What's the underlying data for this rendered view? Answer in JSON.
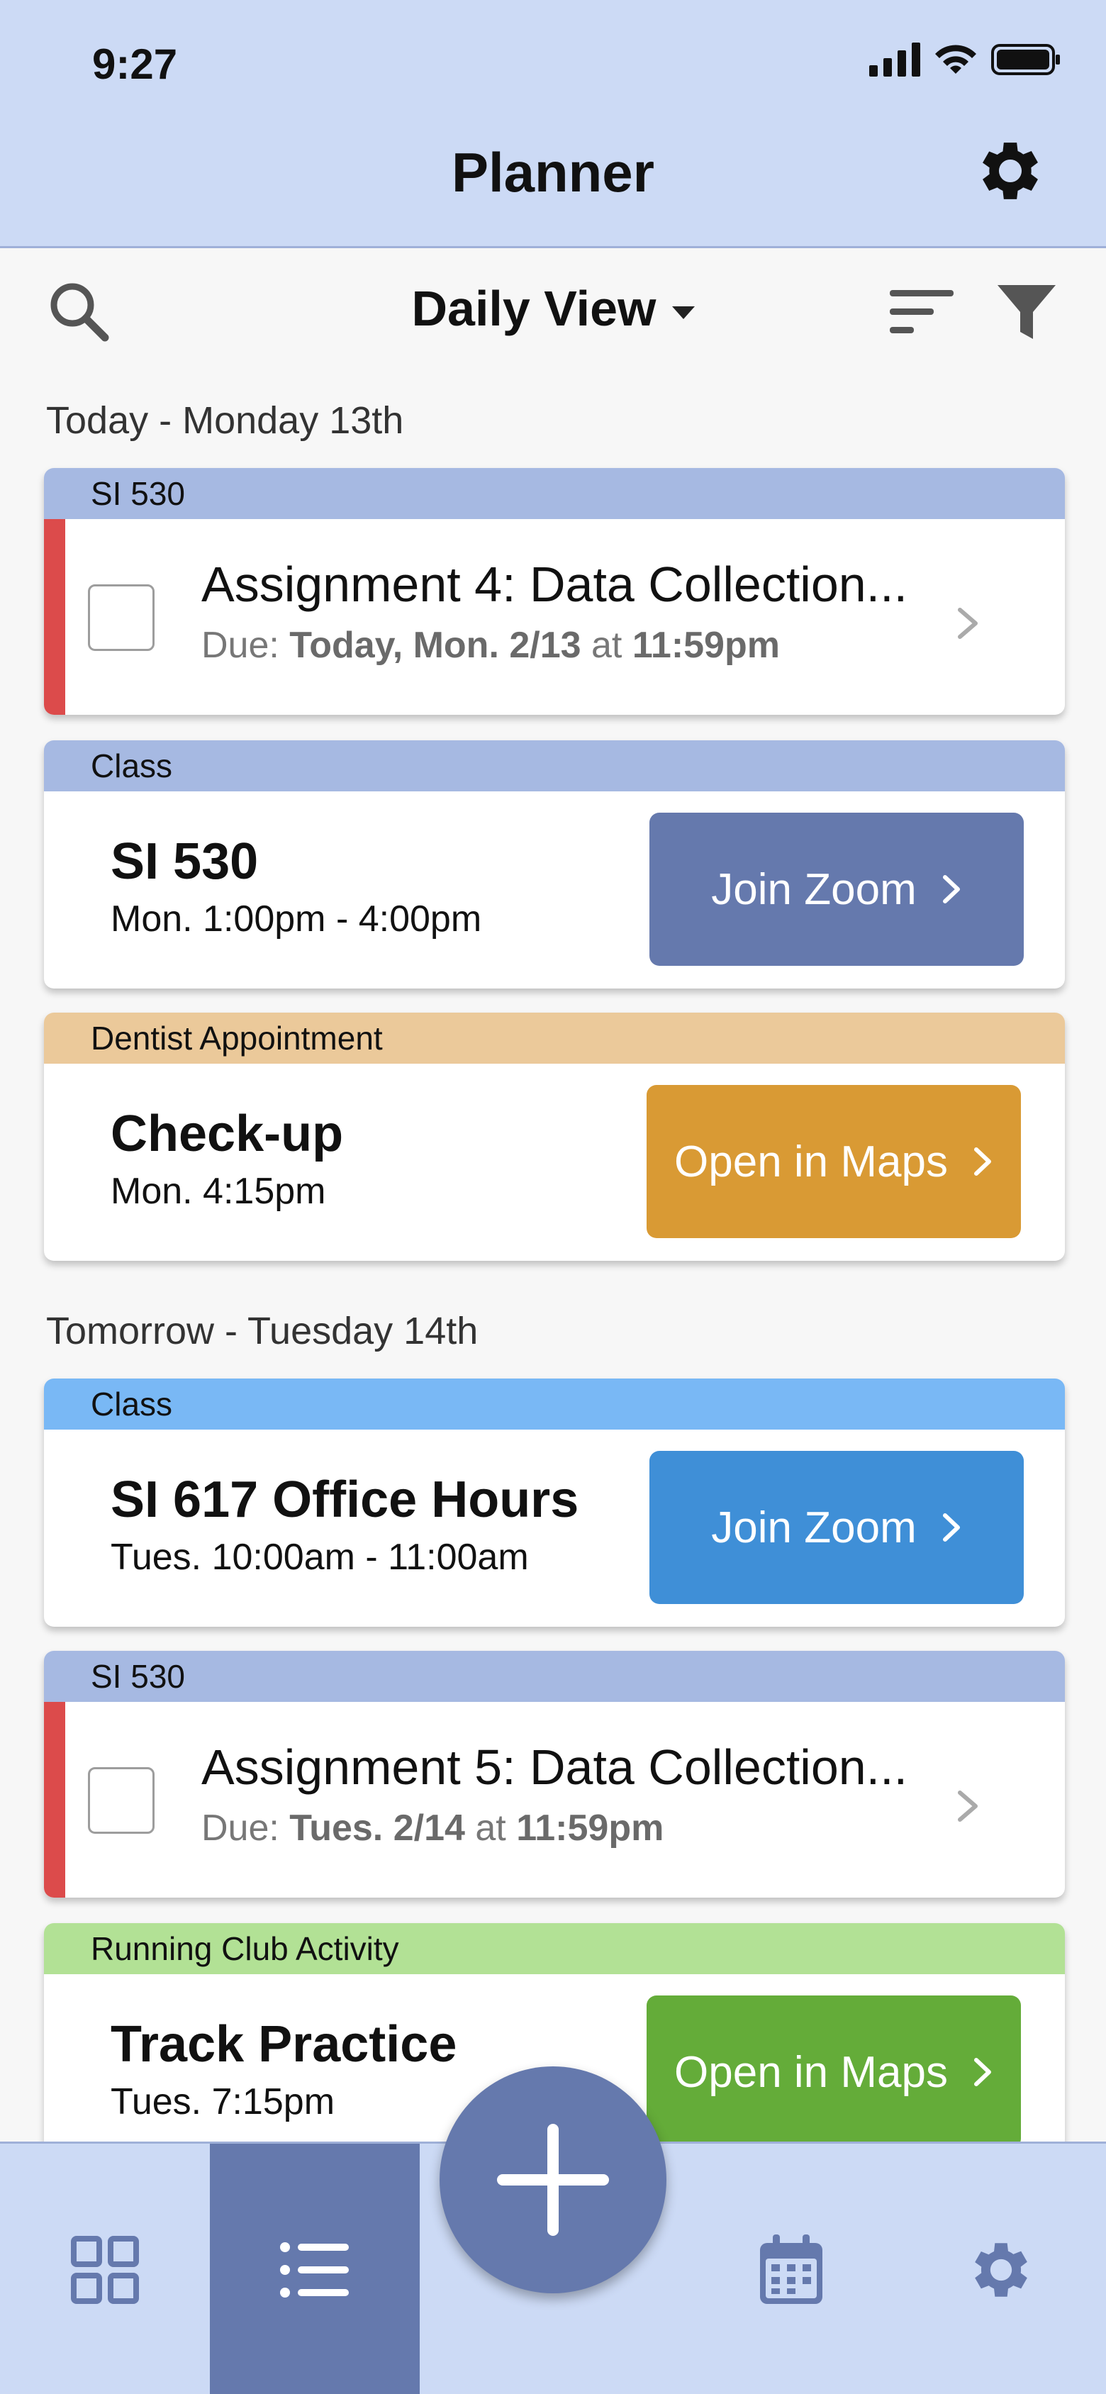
{
  "status_bar": {
    "time": "9:27"
  },
  "header": {
    "title": "Planner"
  },
  "toolbar": {
    "view_label": "Daily View"
  },
  "sections": [
    {
      "heading": "Today - Monday 13th"
    },
    {
      "heading": "Tomorrow - Tuesday 14th"
    }
  ],
  "items": [
    {
      "tag": "SI 530",
      "tag_color": "#a6b9e2",
      "type": "task",
      "title": "Assignment 4: Data Collection...",
      "due_prefix": "Due:",
      "due_date": "Today, Mon. 2/13",
      "due_at": "at",
      "due_time": "11:59pm"
    },
    {
      "tag": "Class",
      "tag_color": "#a6b9e2",
      "type": "event",
      "title": "SI 530",
      "time": "Mon. 1:00pm - 4:00pm",
      "action": "Join Zoom",
      "action_color": "#6579ad"
    },
    {
      "tag": "Dentist Appointment",
      "tag_color": "#ebc99a",
      "type": "event",
      "title": "Check-up",
      "time": "Mon. 4:15pm",
      "action": "Open in Maps",
      "action_color": "#d99a34"
    },
    {
      "tag": "Class",
      "tag_color": "#79b8f5",
      "type": "event",
      "title": "SI 617 Office Hours",
      "time": "Tues. 10:00am - 11:00am",
      "action": "Join Zoom",
      "action_color": "#3f8fd7"
    },
    {
      "tag": "SI 530",
      "tag_color": "#a6b9e2",
      "type": "task",
      "title": "Assignment 5: Data Collection...",
      "due_prefix": "Due:",
      "due_date": "Tues. 2/14",
      "due_at": "at",
      "due_time": "11:59pm"
    },
    {
      "tag": "Running Club Activity",
      "tag_color": "#b2e195",
      "type": "event",
      "title": "Track Practice",
      "time": "Tues. 7:15pm",
      "action": "Open in Maps",
      "action_color": "#64ac39"
    }
  ],
  "tabbar": {
    "tabs": [
      {
        "icon": "grid-icon"
      },
      {
        "icon": "list-icon",
        "active": true
      },
      {
        "icon": "add-icon"
      },
      {
        "icon": "calendar-icon"
      },
      {
        "icon": "gear-icon"
      }
    ]
  },
  "colors": {
    "header_bg": "#ccdaf5",
    "accent": "#6579ad",
    "overdue": "#dc4b4b"
  }
}
